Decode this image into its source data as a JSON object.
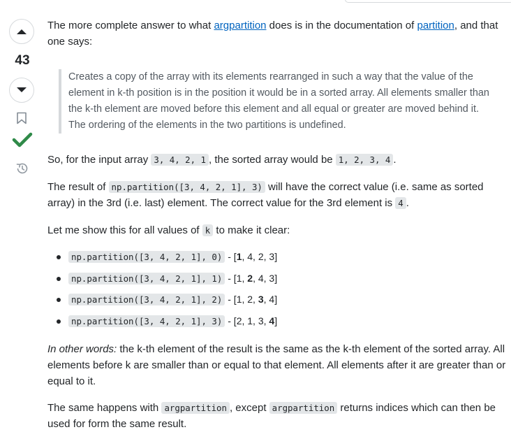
{
  "vote": {
    "count": "43",
    "upvote_label": "Up vote",
    "downvote_label": "Down vote"
  },
  "answer": {
    "intro_before": "The more complete answer to what ",
    "intro_link1": "argpartition",
    "intro_middle": " does is in the documentation of ",
    "intro_link2": "partition",
    "intro_after": ", and that one says:",
    "quote": "Creates a copy of the array with its elements rearranged in such a way that the value of the element in k-th position is in the position it would be in a sorted array. All elements smaller than the k-th element are moved before this element and all equal or greater are moved behind it. The ordering of the elements in the two partitions is undefined.",
    "p1_before": "So, for the input array ",
    "p1_code1": "3, 4, 2, 1",
    "p1_middle": ", the sorted array would be ",
    "p1_code2": "1, 2, 3, 4",
    "p1_after": ".",
    "p2_before": "The result of ",
    "p2_code": "np.partition([3, 4, 2, 1], 3)",
    "p2_middle": " will have the correct value (i.e. same as sorted array) in the 3rd (i.e. last) element. The correct value for the 3rd element is ",
    "p2_code2": "4",
    "p2_after": ".",
    "p3_before": "Let me show this for all values of ",
    "p3_code": "k",
    "p3_after": " to make it clear:",
    "list": [
      {
        "code": "np.partition([3, 4, 2, 1], 0)",
        "sep": " - ",
        "open": "[",
        "pre": "",
        "bold": "1",
        "post": ", 4, 2, 3",
        "close": "]"
      },
      {
        "code": "np.partition([3, 4, 2, 1], 1)",
        "sep": " - ",
        "open": "[",
        "pre": "1, ",
        "bold": "2",
        "post": ", 4, 3",
        "close": "]"
      },
      {
        "code": "np.partition([3, 4, 2, 1], 2)",
        "sep": " - ",
        "open": "[",
        "pre": "1, 2, ",
        "bold": "3",
        "post": ", 4",
        "close": "]"
      },
      {
        "code": "np.partition([3, 4, 2, 1], 3)",
        "sep": " - ",
        "open": "[",
        "pre": "2, 1, 3, ",
        "bold": "4",
        "post": "",
        "close": "]"
      }
    ],
    "p4_italic": "In other words:",
    "p4_rest": " the k-th element of the result is the same as the k-th element of the sorted array. All elements before k are smaller than or equal to that element. All elements after it are greater than or equal to it.",
    "p5_before": "The same happens with ",
    "p5_code1": "argpartition",
    "p5_middle": ", except ",
    "p5_code2": "argpartition",
    "p5_after": " returns indices which can then be used for form the same result."
  },
  "colors": {
    "link": "#0063bf",
    "accepted_check": "#2f8a48",
    "code_bg": "#e3e6e8"
  },
  "icons": [
    "upvote-arrow-icon",
    "downvote-arrow-icon",
    "bookmark-icon",
    "accepted-check-icon",
    "history-icon"
  ]
}
